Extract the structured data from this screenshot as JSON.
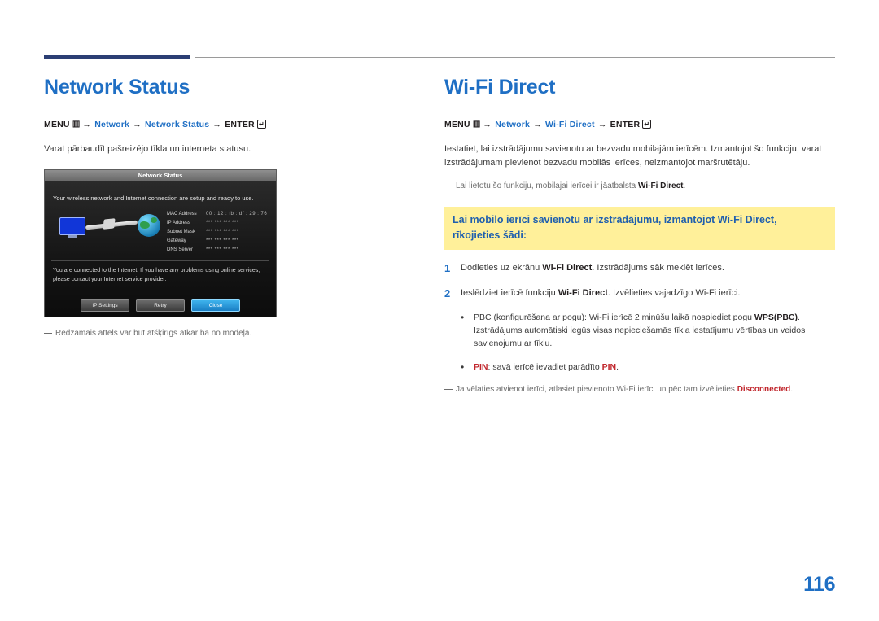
{
  "page": {
    "number": "116"
  },
  "left": {
    "title": "Network Status",
    "menupath": {
      "menu": "MENU",
      "menu_icon": "menu-bars-icon",
      "arrow": "→",
      "items": [
        "Network",
        "Network Status"
      ],
      "enter": "ENTER",
      "enter_icon": "enter-key-icon"
    },
    "description": "Varat pārbaudīt pašreizējo tīkla un interneta statusu.",
    "note": "Redzamais attēls var būt atšķirīgs atkarībā no modeļa.",
    "tv": {
      "window_title": "Network Status",
      "line1": "Your wireless network and Internet connection are setup and ready to use.",
      "table": [
        {
          "key": "MAC Address",
          "value": "00 : 12 : fb : df : 29 : 76"
        },
        {
          "key": "IP Address",
          "value": "***  ***  ***  ***"
        },
        {
          "key": "Subnet Mask",
          "value": "***  ***  ***  ***"
        },
        {
          "key": "Gateway",
          "value": "***  ***  ***  ***"
        },
        {
          "key": "DNS Server",
          "value": "***  ***  ***  ***"
        }
      ],
      "status": "You are connected to the Internet. If you have any problems using online services, please contact your Internet service provider.",
      "buttons": [
        {
          "label": "IP Settings",
          "selected": false
        },
        {
          "label": "Retry",
          "selected": false
        },
        {
          "label": "Close",
          "selected": true
        }
      ]
    }
  },
  "right": {
    "title": "Wi-Fi Direct",
    "menupath": {
      "menu": "MENU",
      "menu_icon": "menu-bars-icon",
      "arrow": "→",
      "items": [
        "Network",
        "Wi-Fi Direct"
      ],
      "enter": "ENTER",
      "enter_icon": "enter-key-icon"
    },
    "description": "Iestatiet, lai izstrādājumu savienotu ar bezvadu mobilajām ierīcēm. Izmantojot šo funkciju, varat izstrādājumam pievienot bezvadu mobilās ierīces, neizmantojot maršrutētāju.",
    "note_top": {
      "prefix": "Lai lietotu šo funkciju, mobilajai ierīcei ir jāatbalsta ",
      "bold": "Wi-Fi Direct",
      "suffix": "."
    },
    "highlight": "Lai mobilo ierīci savienotu ar izstrādājumu, izmantojot Wi-Fi Direct, rīkojieties šādi:",
    "steps": [
      {
        "num": "1",
        "prefix": "Dodieties uz ekrānu ",
        "bold": "Wi-Fi Direct",
        "suffix": ". Izstrādājums sāk meklēt ierīces."
      },
      {
        "num": "2",
        "prefix": "Ieslēdziet ierīcē funkciju ",
        "bold": "Wi-Fi Direct",
        "suffix": ". Izvēlieties vajadzīgo Wi-Fi ierīci."
      }
    ],
    "bullets": [
      {
        "prefix": "PBC (konfigurēšana ar pogu): Wi-Fi ierīcē 2 minūšu laikā nospiediet pogu ",
        "bold": "WPS(PBC)",
        "suffix": ". Izstrādājums automātiski iegūs visas nepieciešamās tīkla iestatījumu vērtības un veidos savienojumu ar tīklu."
      },
      {
        "bold_red_lead": "PIN",
        "prefix": ": savā ierīcē ievadiet parādīto ",
        "bold_red": "PIN",
        "suffix": "."
      }
    ],
    "note_bottom": {
      "prefix": "Ja vēlaties atvienot ierīci, atlasiet pievienoto Wi-Fi ierīci un pēc tam izvēlieties ",
      "bold_red": "Disconnected",
      "suffix": "."
    }
  }
}
